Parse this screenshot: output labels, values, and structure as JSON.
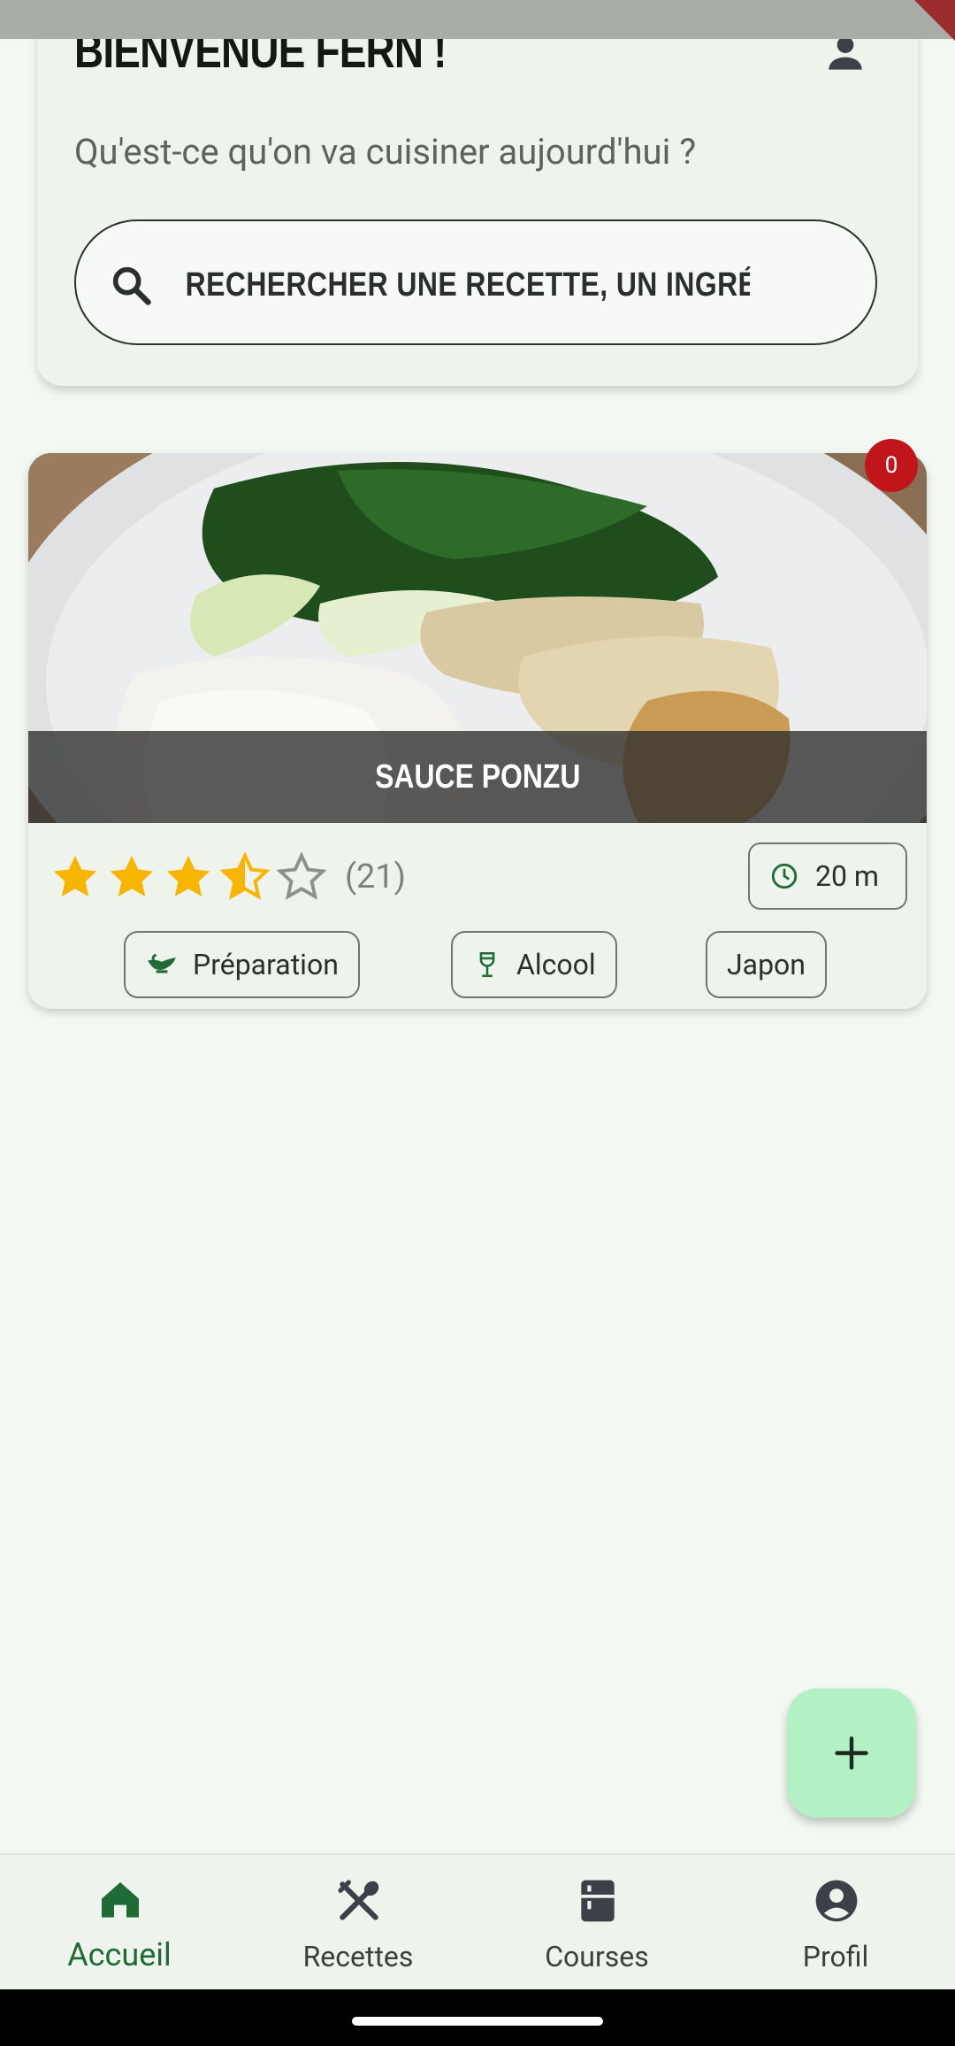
{
  "header": {
    "welcome": "BIENVENUE FERN !",
    "subtitle": "Qu'est-ce qu'on va cuisiner aujourd'hui ?",
    "search_placeholder": "RECHERCHER UNE RECETTE, UN INGRÉDIENT..."
  },
  "recipe": {
    "title": "SAUCE PONZU",
    "badge_count": "0",
    "rating_value": 3.5,
    "rating_max": 5,
    "rating_count": "(21)",
    "time": "20 m",
    "tags": [
      {
        "label": "Préparation",
        "icon": "gravy-boat-icon"
      },
      {
        "label": "Alcool",
        "icon": "wine-glass-icon"
      },
      {
        "label": "Japon",
        "icon": ""
      }
    ]
  },
  "nav": {
    "items": [
      {
        "label": "Accueil",
        "icon": "home-icon",
        "active": true
      },
      {
        "label": "Recettes",
        "icon": "utensils-icon",
        "active": false
      },
      {
        "label": "Courses",
        "icon": "fridge-icon",
        "active": false
      },
      {
        "label": "Profil",
        "icon": "account-circle-icon",
        "active": false
      }
    ]
  },
  "colors": {
    "accent": "#1f6b35",
    "fab": "#b3f0c4",
    "badge": "#c0151b",
    "star": "#f7b500"
  }
}
